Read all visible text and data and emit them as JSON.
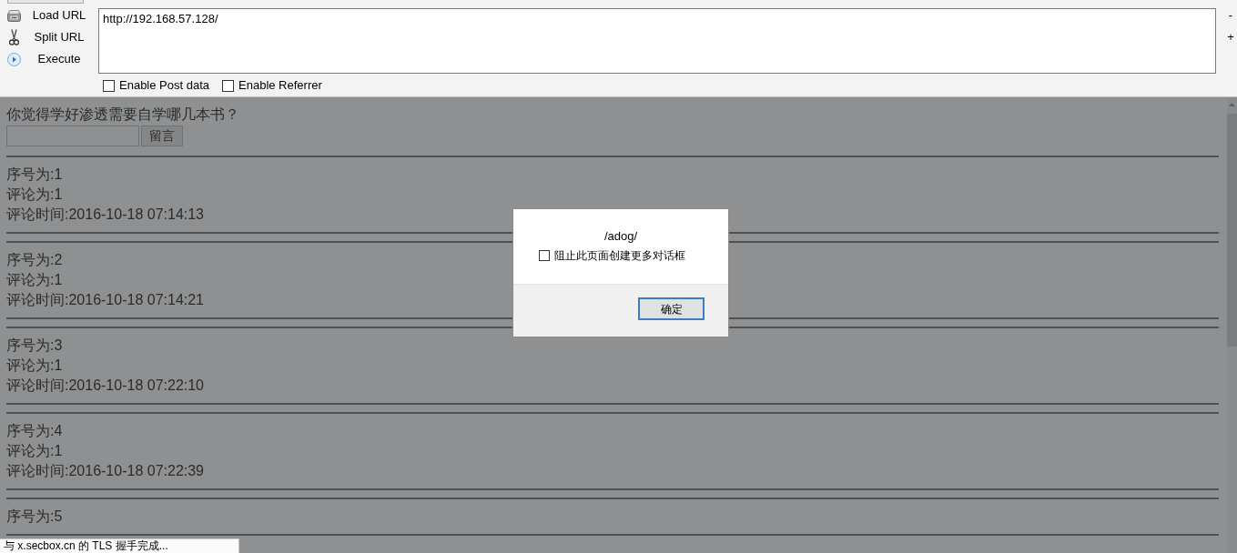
{
  "toolbar": {
    "actions": [
      {
        "kind": "load",
        "label": "Load URL"
      },
      {
        "kind": "split",
        "label": "Split URL"
      },
      {
        "kind": "execute",
        "label": "Execute"
      }
    ],
    "url_field": {
      "value": "http://192.168.57.128/"
    },
    "zoom_buttons": [
      "-",
      "+"
    ],
    "options": [
      {
        "label": "Enable Post data",
        "checked": false
      },
      {
        "label": "Enable Referrer",
        "checked": false
      }
    ]
  },
  "page": {
    "question": "你觉得学好渗透需要自学哪几本书？",
    "submit_button": "留言",
    "entries": [
      {
        "lines": [
          "序号为:1",
          "评论为:1",
          "评论时间:2016-10-18 07:14:13"
        ]
      },
      {
        "lines": [
          "序号为:2",
          "评论为:1",
          "评论时间:2016-10-18 07:14:21"
        ]
      },
      {
        "lines": [
          "序号为:3",
          "评论为:1",
          "评论时间:2016-10-18 07:22:10"
        ]
      },
      {
        "lines": [
          "序号为:4",
          "评论为:1",
          "评论时间:2016-10-18 07:22:39"
        ]
      },
      {
        "lines": [
          "序号为:5"
        ]
      }
    ]
  },
  "dialog": {
    "message": "/adog/",
    "option": {
      "label": "阻止此页面创建更多对话框",
      "checked": false
    },
    "buttons": [
      {
        "label": "确定",
        "focused": true
      }
    ]
  },
  "status_bar": {
    "text": "与 x.secbox.cn 的 TLS 握手完成..."
  }
}
